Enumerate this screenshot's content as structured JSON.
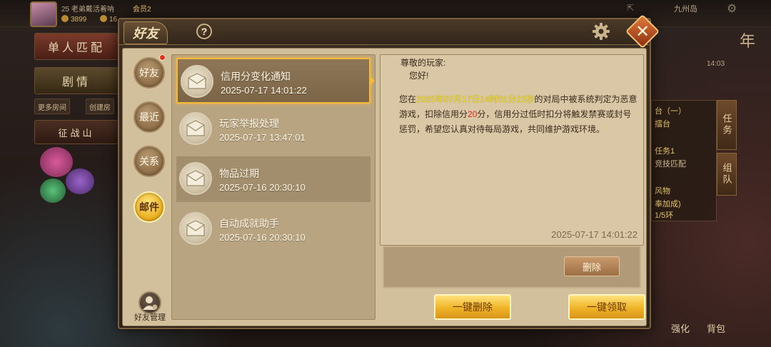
{
  "background": {
    "player": {
      "level_name": "25  老弟戴活着呐",
      "vip": "会员2",
      "coins": "3899",
      "gold_partial": "16"
    },
    "left_menu": {
      "single_match": "单人匹配",
      "story": "剧情",
      "more_rooms": "更多房间",
      "create_room_partial": "创建房",
      "campaign_partial": "征战山"
    },
    "top_right": {
      "location": "九州岛",
      "time": "14:03",
      "year_partial": "年"
    },
    "right_panel": {
      "task_tab": "任务",
      "team_tab": "组队",
      "lines": [
        "台（一）",
        "擂台",
        "任务1",
        "竞技匹配",
        "风物",
        "奉加成)",
        "1/5环"
      ]
    },
    "bottom_right": {
      "strengthen_partial": "强化",
      "bag": "背包"
    }
  },
  "modal": {
    "title": "好友",
    "help_label": "?",
    "close_label": "✕",
    "rail": [
      {
        "label": "好友",
        "has_notice": true,
        "active": false
      },
      {
        "label": "最近",
        "has_notice": false,
        "active": false
      },
      {
        "label": "关系",
        "has_notice": false,
        "active": false
      },
      {
        "label": "邮件",
        "has_notice": false,
        "active": true
      }
    ],
    "friend_manage": "好友管理",
    "mails": [
      {
        "title": "信用分变化通知",
        "date": "2025-07-17 14:01:22",
        "selected": true
      },
      {
        "title": "玩家举报处理",
        "date": "2025-07-17 13:47:01",
        "selected": false
      },
      {
        "title": "物品过期",
        "date": "2025-07-16 20:30:10",
        "selected": false
      },
      {
        "title": "自动成就助手",
        "date": "2025-07-16 20:30:10",
        "selected": false
      }
    ],
    "message": {
      "greeting": "尊敬的玩家:",
      "hello": "您好!",
      "part1": "您在",
      "time_highlight": "2025年07月17日14时01分22秒",
      "part2": "的对局中被系统判定为恶意游戏，扣除信用分",
      "score_highlight": "20",
      "part3": "分，信用分过低时扣分将触发禁赛或封号惩罚，希望您认真对待每局游戏，共同维护游戏环境。",
      "date": "2025-07-17 14:01:22"
    },
    "buttons": {
      "delete": "删除",
      "delete_all": "一键删除",
      "claim_all": "一键领取"
    },
    "colors": {
      "accent_gold": "#efb327",
      "highlight_yellow": "#f5e22a",
      "highlight_red": "#e0281c"
    }
  }
}
